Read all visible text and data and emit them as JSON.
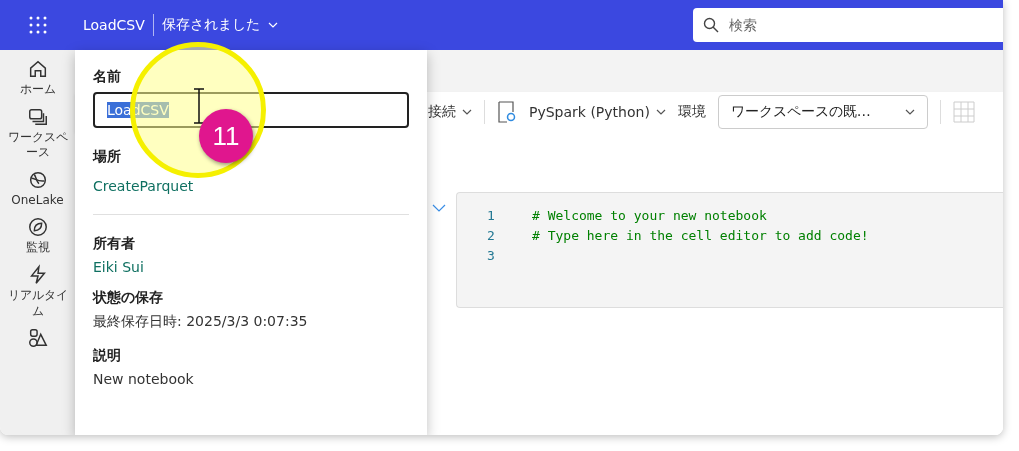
{
  "topbar": {
    "item_name": "LoadCSV",
    "save_status": "保存されました",
    "search": {
      "placeholder": "検索"
    }
  },
  "sidebar": {
    "items": [
      {
        "label": "ホーム"
      },
      {
        "label": "ワークスペース"
      },
      {
        "label": "OneLake"
      },
      {
        "label": "監視"
      },
      {
        "label": "リアルタイム"
      }
    ]
  },
  "toolbar": {
    "connect": "接続",
    "language": "PySpark (Python)",
    "environment_label": "環境",
    "environment": "ワークスペースの既…"
  },
  "cell": {
    "lines": [
      {
        "number": "1",
        "code": "# Welcome to your new notebook"
      },
      {
        "number": "2",
        "code": "# Type here in the cell editor to add code!"
      },
      {
        "number": "3"
      }
    ]
  },
  "popup": {
    "name_label": "名前",
    "name_value": "LoadCSV",
    "location_label": "場所",
    "location": "CreateParquet",
    "owner_label": "所有者",
    "owner": "Eiki Sui",
    "save_label": "状態の保存",
    "save_time": "最終保存日時: 2025/3/3 0:07:35",
    "description_label": "説明",
    "description": "New notebook"
  },
  "callout": {
    "number": "11"
  }
}
